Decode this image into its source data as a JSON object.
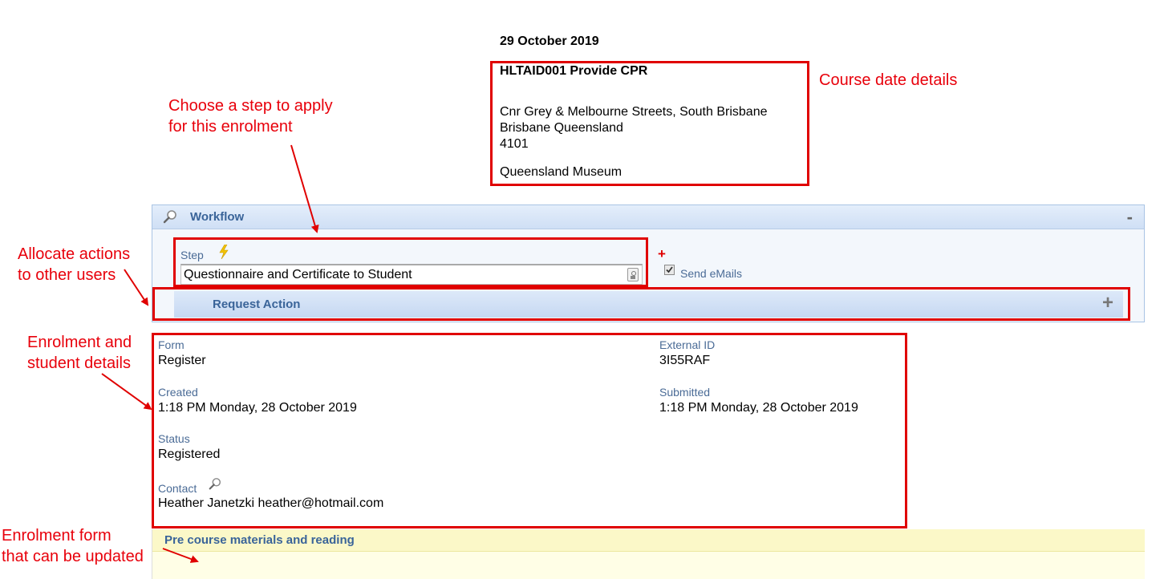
{
  "course": {
    "date": "29 October 2019",
    "title": "HLTAID001 Provide CPR",
    "address_line1": "Cnr Grey & Melbourne Streets, South Brisbane",
    "address_line2": "Brisbane Queensland",
    "postcode": "4101",
    "venue": "Queensland Museum"
  },
  "workflow": {
    "title": "Workflow",
    "collapse": "-",
    "step_label": "Step",
    "step_value": "Questionnaire and Certificate to Student",
    "add_symbol": "+",
    "send_emails_label": "Send eMails",
    "send_emails_checked": true,
    "request_action_label": "Request Action",
    "request_action_expand": "+"
  },
  "details": {
    "form_label": "Form",
    "form_value": "Register",
    "external_id_label": "External ID",
    "external_id_value": "3I55RAF",
    "created_label": "Created",
    "created_value": "1:18 PM Monday, 28 October 2019",
    "submitted_label": "Submitted",
    "submitted_value": "1:18 PM Monday, 28 October 2019",
    "status_label": "Status",
    "status_value": "Registered",
    "contact_label": "Contact",
    "contact_value": "Heather Janetzki heather@hotmail.com"
  },
  "pre_course": {
    "title": "Pre course materials and reading"
  },
  "annotations": {
    "course_date_details": "Course date details",
    "choose_step_line1": "Choose a step to apply",
    "choose_step_line2": "for this enrolment",
    "allocate_line1": "Allocate actions",
    "allocate_line2": "to other users",
    "enrolment_line1": "Enrolment and",
    "enrolment_line2": "student details",
    "form_line1": "Enrolment form",
    "form_line2": "that can be updated"
  },
  "colors": {
    "annotation_red": "#e8000b",
    "panel_header_blue": "#cfdff5",
    "label_blue": "#4a6b96",
    "pre_course_yellow": "#fbf8c8"
  },
  "icons": [
    "magnifier-icon",
    "lightning-icon",
    "dropdown-picker-icon",
    "checkbox-icon",
    "plus-icon",
    "minus-icon"
  ]
}
